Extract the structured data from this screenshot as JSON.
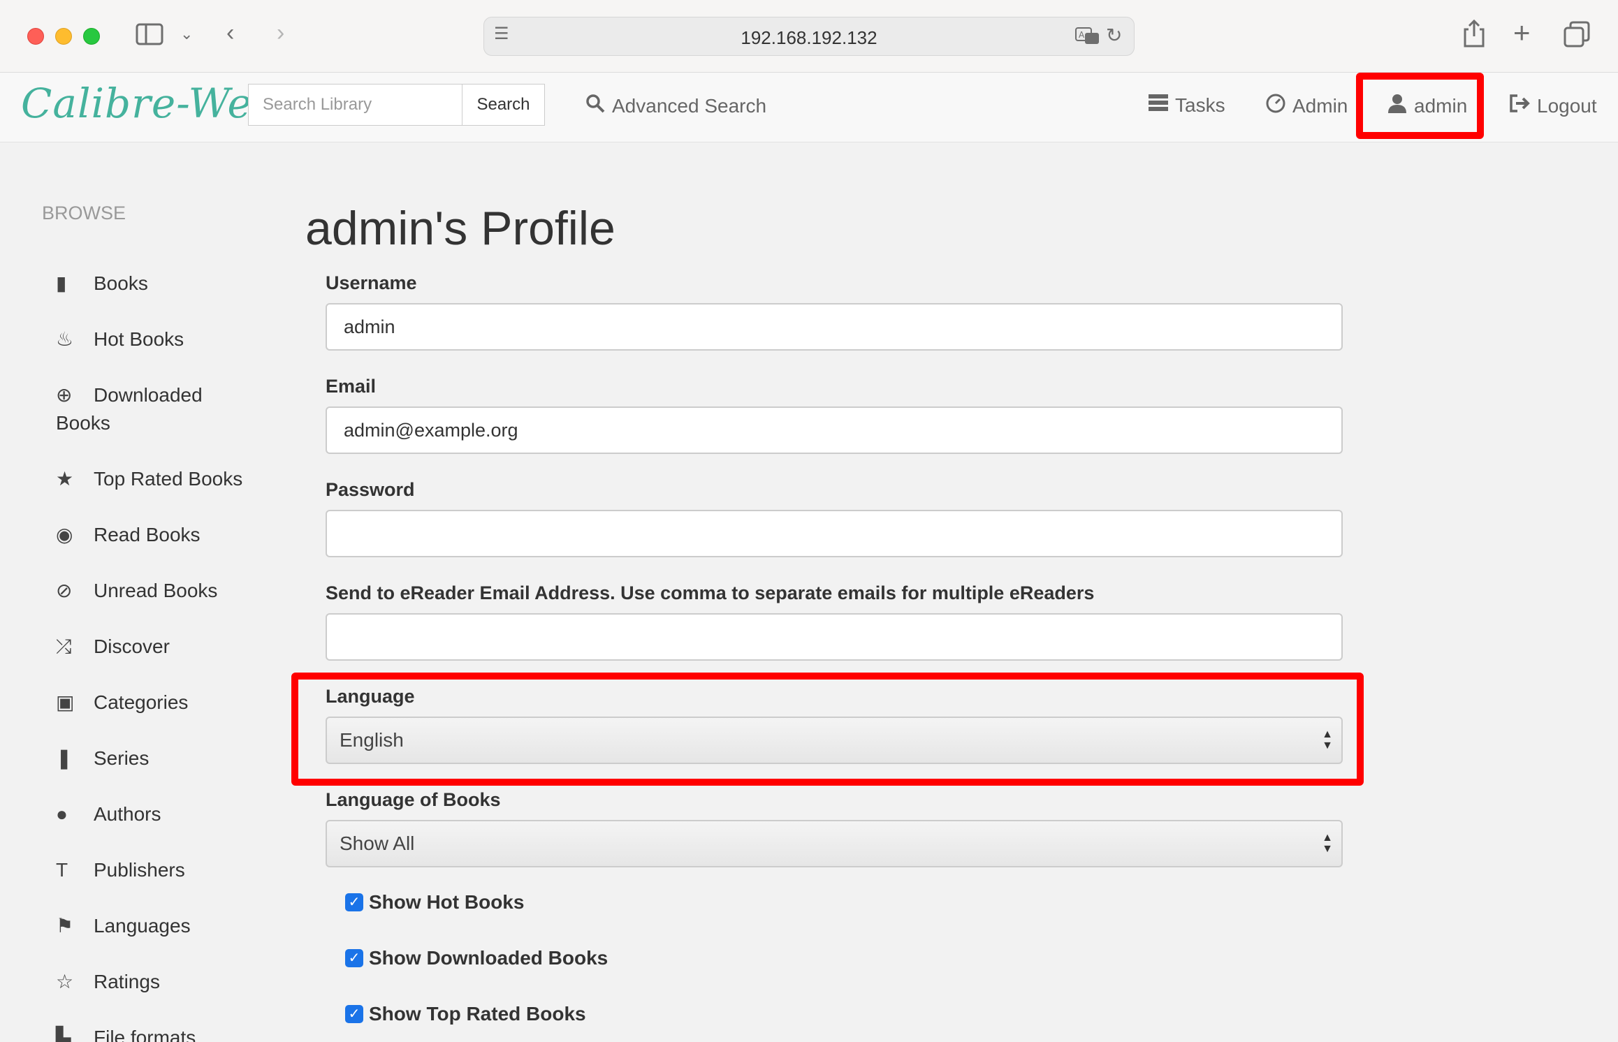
{
  "browser": {
    "url": "192.168.192.132"
  },
  "navbar": {
    "logo": "Calibre-Web",
    "search_placeholder": "Search Library",
    "search_button": "Search",
    "advanced_search": "Advanced Search",
    "tasks": "Tasks",
    "admin": "Admin",
    "user": "admin",
    "logout": "Logout"
  },
  "sidebar": {
    "heading": "BROWSE",
    "items": [
      {
        "label": "Books",
        "icon": "book-icon"
      },
      {
        "label": "Hot Books",
        "icon": "fire-icon"
      },
      {
        "label": "Downloaded Books",
        "icon": "download-icon"
      },
      {
        "label": "Top Rated Books",
        "icon": "star-icon"
      },
      {
        "label": "Read Books",
        "icon": "eye-icon"
      },
      {
        "label": "Unread Books",
        "icon": "eye-slash-icon"
      },
      {
        "label": "Discover",
        "icon": "shuffle-icon"
      },
      {
        "label": "Categories",
        "icon": "inbox-icon"
      },
      {
        "label": "Series",
        "icon": "bookmark-icon"
      },
      {
        "label": "Authors",
        "icon": "user-icon"
      },
      {
        "label": "Publishers",
        "icon": "text-size-icon"
      },
      {
        "label": "Languages",
        "icon": "flag-icon"
      },
      {
        "label": "Ratings",
        "icon": "star-empty-icon"
      },
      {
        "label": "File formats",
        "icon": "file-icon"
      }
    ]
  },
  "profile": {
    "title": "admin's Profile",
    "username_label": "Username",
    "username_value": "admin",
    "email_label": "Email",
    "email_value": "admin@example.org",
    "password_label": "Password",
    "password_value": "",
    "ereader_label": "Send to eReader Email Address. Use comma to separate emails for multiple eReaders",
    "ereader_value": "",
    "language_label": "Language",
    "language_value": "English",
    "book_language_label": "Language of Books",
    "book_language_value": "Show All",
    "checkboxes": [
      {
        "label": "Show Hot Books",
        "checked": true
      },
      {
        "label": "Show Downloaded Books",
        "checked": true
      },
      {
        "label": "Show Top Rated Books",
        "checked": true
      }
    ]
  },
  "colors": {
    "logo": "#45b29d",
    "highlight": "#ff0000",
    "checkbox": "#1a73e8"
  }
}
